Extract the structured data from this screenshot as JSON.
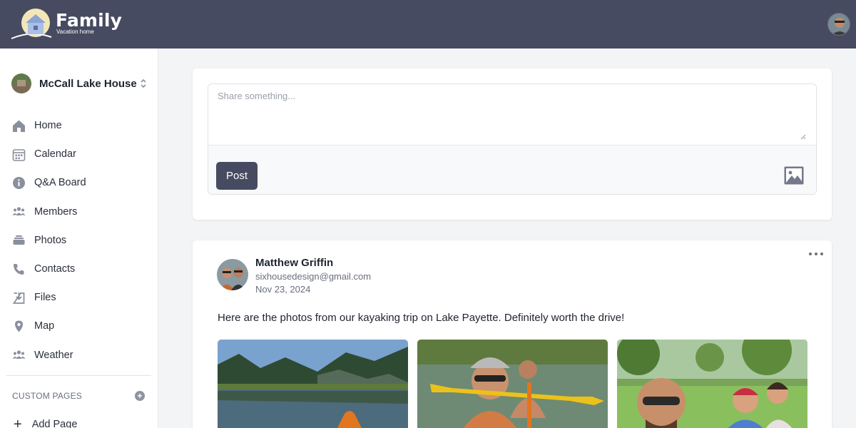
{
  "header": {
    "logo_title": "Family",
    "logo_subtitle": "Vacation home"
  },
  "sidebar": {
    "house_name": "McCall Lake House",
    "items": [
      {
        "label": "Home",
        "icon": "home-icon"
      },
      {
        "label": "Calendar",
        "icon": "calendar-icon"
      },
      {
        "label": "Q&A Board",
        "icon": "info-icon"
      },
      {
        "label": "Members",
        "icon": "members-icon"
      },
      {
        "label": "Photos",
        "icon": "photos-icon"
      },
      {
        "label": "Contacts",
        "icon": "phone-icon"
      },
      {
        "label": "Files",
        "icon": "files-icon"
      },
      {
        "label": "Map",
        "icon": "map-pin-icon"
      },
      {
        "label": "Weather",
        "icon": "weather-icon"
      }
    ],
    "custom_pages_heading": "CUSTOM PAGES",
    "add_page_label": "Add Page"
  },
  "composer": {
    "placeholder": "Share something...",
    "post_label": "Post"
  },
  "post": {
    "author": "Matthew Griffin",
    "email": "sixhousedesign@gmail.com",
    "date": "Nov 23, 2024",
    "text": "Here are the photos from our kayaking trip on Lake Payette. Definitely worth the drive!",
    "photos": [
      "lake-kayak-photo",
      "kayak-selfie-photo",
      "park-selfie-photo"
    ]
  },
  "colors": {
    "topbar": "#474b61",
    "accent_button": "#474b61",
    "page_background": "#f3f4f6"
  }
}
